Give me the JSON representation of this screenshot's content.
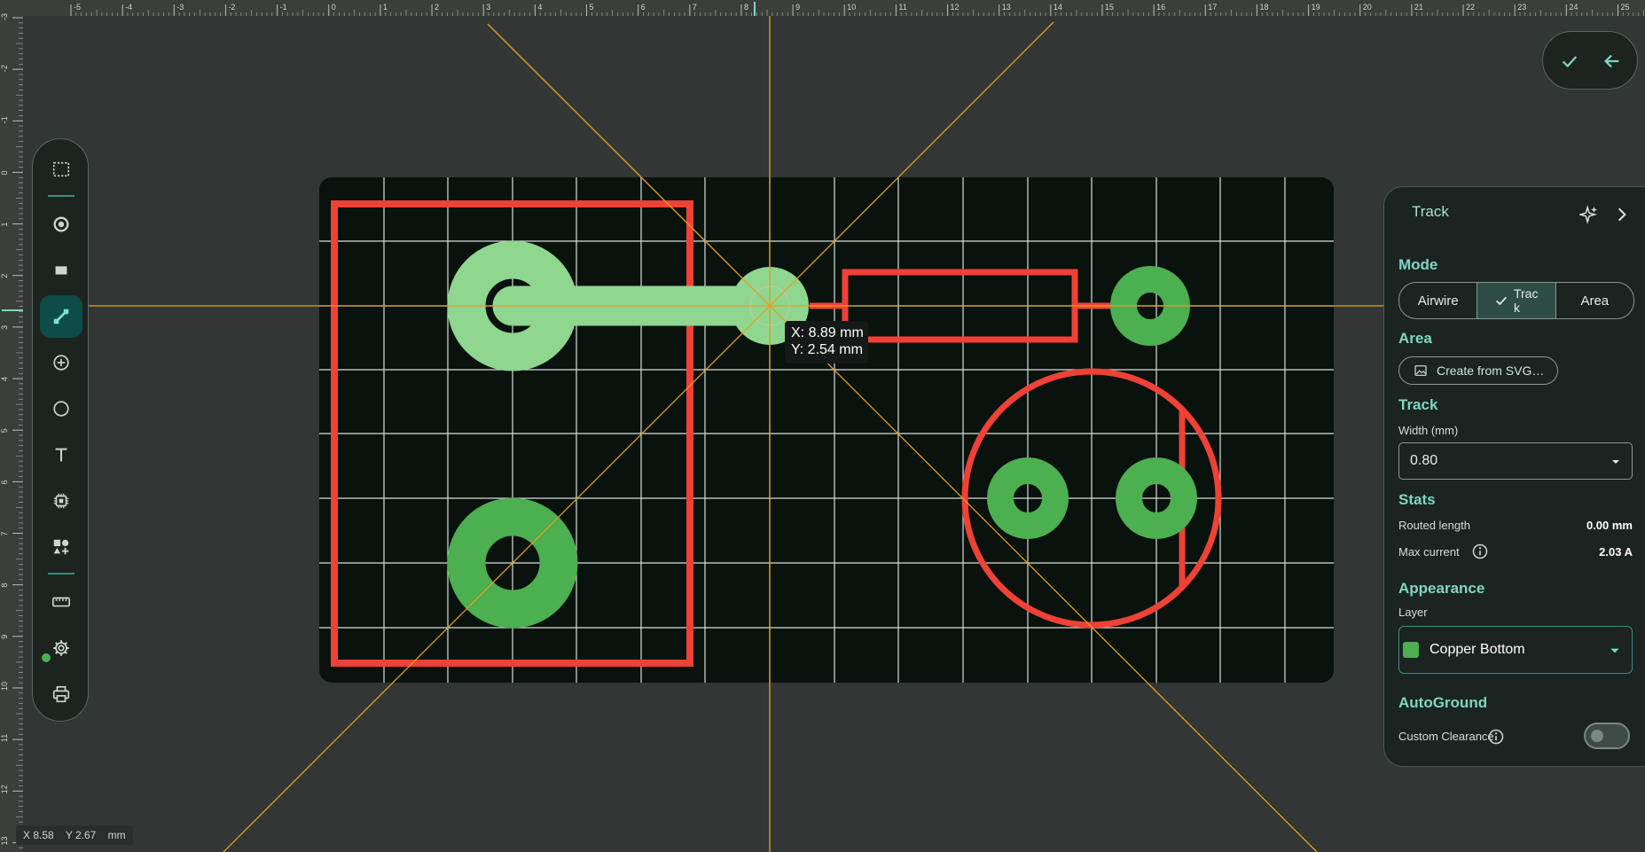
{
  "colors": {
    "background": "#323634",
    "board": "#0a120e",
    "grid": "#d9dfdb",
    "silkscreen_red": "#ef4136",
    "copper_bottom": "#4caf50",
    "copper_top_light": "#8fd68f",
    "guide_orange": "#e6a020",
    "accent_teal": "#7fd6c4"
  },
  "ruler": {
    "top_ticks": [
      "-5",
      "-4",
      "-3",
      "-2",
      "-1",
      "0",
      "1",
      "2",
      "3",
      "4",
      "5",
      "6",
      "7",
      "8",
      "9",
      "10",
      "11",
      "12",
      "13",
      "14",
      "15",
      "16",
      "17",
      "18",
      "19",
      "20",
      "21",
      "22",
      "23",
      "24",
      "25"
    ],
    "left_ticks": [
      "-3",
      "-2",
      "-1",
      "0",
      "1",
      "2",
      "3",
      "4",
      "5",
      "6",
      "7",
      "8",
      "9",
      "10",
      "11",
      "12",
      "13"
    ]
  },
  "cursor_tooltip": {
    "x": "X: 8.89 mm",
    "y": "Y: 2.54 mm"
  },
  "status_bar": {
    "x": "X 8.58",
    "y": "Y 2.67",
    "unit": "mm"
  },
  "toolbar": {
    "tools": [
      {
        "icon": "select-rectangle-icon"
      },
      {
        "icon": "pad-icon"
      },
      {
        "icon": "rectangle-icon"
      },
      {
        "icon": "track-icon",
        "active": true
      },
      {
        "icon": "add-circle-icon"
      },
      {
        "icon": "circle-icon"
      },
      {
        "icon": "text-icon"
      },
      {
        "icon": "chip-icon"
      },
      {
        "icon": "shapes-icon"
      },
      {
        "icon": "ruler-icon"
      },
      {
        "icon": "settings-icon"
      },
      {
        "icon": "print-icon"
      }
    ]
  },
  "top_actions": {
    "confirm_icon": "check-icon",
    "back_icon": "arrow-left-icon"
  },
  "panel": {
    "title": "Track",
    "mode": {
      "heading": "Mode",
      "options": [
        "Airwire",
        "Track",
        "Area"
      ],
      "selected": "Track"
    },
    "area": {
      "heading": "Area",
      "button_label": "Create from SVG…"
    },
    "track": {
      "heading": "Track",
      "width_label": "Width (mm)",
      "width_value": "0.80"
    },
    "stats": {
      "heading": "Stats",
      "routed_length_label": "Routed length",
      "routed_length_value": "0.00 mm",
      "max_current_label": "Max current",
      "max_current_value": "2.03 A"
    },
    "appearance": {
      "heading": "Appearance",
      "layer_label": "Layer",
      "layer_value": "Copper Bottom"
    },
    "autoground": {
      "heading": "AutoGround",
      "custom_clearance_label": "Custom Clearance",
      "custom_clearance_on": false
    }
  }
}
